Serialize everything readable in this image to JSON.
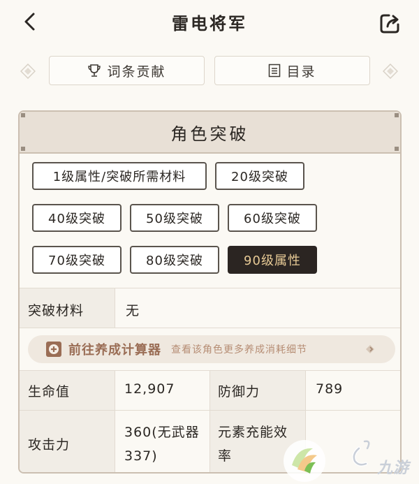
{
  "header": {
    "title": "雷电将军"
  },
  "tabs": [
    {
      "label": "词条贡献",
      "icon": "trophy-icon"
    },
    {
      "label": "目录",
      "icon": "list-icon"
    }
  ],
  "section": {
    "title": "角色突破",
    "levels": [
      "1级属性/突破所需材料",
      "20级突破",
      "40级突破",
      "50级突破",
      "60级突破",
      "70级突破",
      "80级突破",
      "90级属性"
    ],
    "selected": "90级属性",
    "material_label": "突破材料",
    "material_value": "无",
    "calc_title": "前往养成计算器",
    "calc_desc": "查看该角色更多养成消耗细节",
    "stats": [
      {
        "label": "生命值",
        "value": "12,907"
      },
      {
        "label": "防御力",
        "value": "789"
      },
      {
        "label": "攻击力",
        "value": "360(无武器337)"
      },
      {
        "label": "元素充能效率",
        "value": ""
      }
    ],
    "attack_value_lines": [
      "360(无武器",
      "337)"
    ],
    "er_label_lines": [
      "元素充能效",
      "率"
    ]
  },
  "watermark": {
    "text": "九游"
  },
  "colors": {
    "accent_dark": "#2b2522",
    "accent_gold": "#e6c995",
    "calc_brown": "#9a6d55",
    "border": "#cbbfb1"
  }
}
